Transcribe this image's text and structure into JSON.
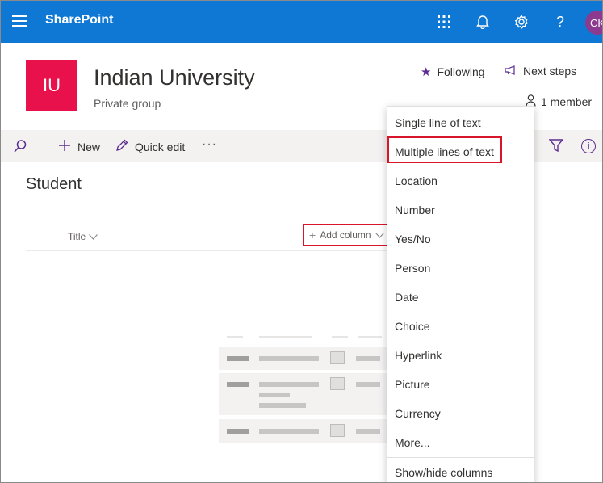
{
  "suitebar": {
    "brand": "SharePoint",
    "avatar_initials": "CK",
    "help_glyph": "?",
    "icons": [
      "waffle-icon",
      "grid-apps-icon",
      "bell-icon",
      "gear-icon",
      "help-icon"
    ]
  },
  "site": {
    "logo_text": "IU",
    "title": "Indian University",
    "subtitle": "Private group",
    "following_label": "Following",
    "next_steps_label": "Next steps",
    "members_label": "1 member",
    "logo_color": "#e8114b"
  },
  "commandbar": {
    "new_label": "New",
    "quick_edit_label": "Quick edit",
    "more_label": "···",
    "info_glyph": "i"
  },
  "list": {
    "title": "Student",
    "columns": {
      "title_label": "Title",
      "add_column_label": "Add column"
    }
  },
  "add_column_menu": {
    "items": [
      "Single line of text",
      "Multiple lines of text",
      "Location",
      "Number",
      "Yes/No",
      "Person",
      "Date",
      "Choice",
      "Hyperlink",
      "Picture",
      "Currency",
      "More...",
      "Show/hide columns"
    ],
    "highlighted_item": "Multiple lines of text"
  },
  "colors": {
    "suitebar": "#0f78d4",
    "accent": "#5c2d91",
    "highlight_border": "#d9152b"
  }
}
